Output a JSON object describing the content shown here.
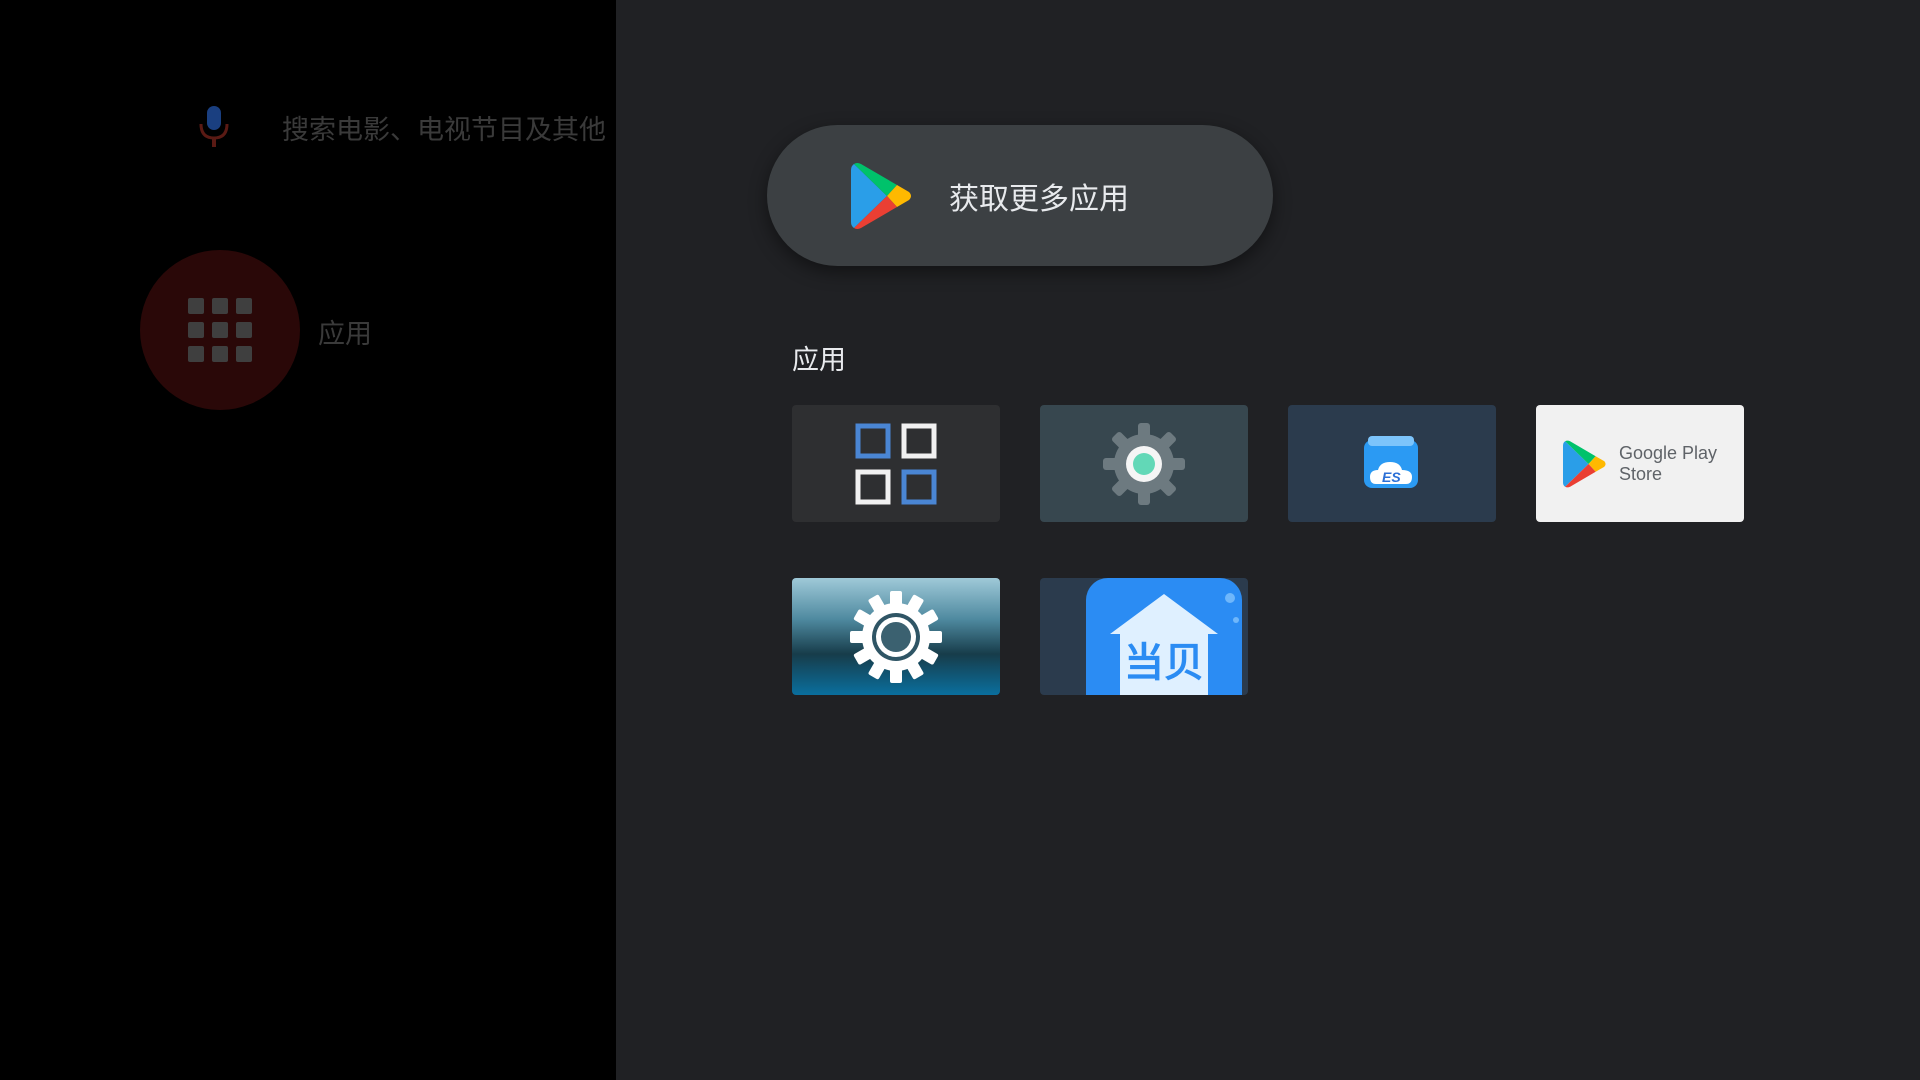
{
  "search": {
    "placeholder": "搜索电影、电视节目及其他"
  },
  "home": {
    "apps_label": "应用"
  },
  "panel": {
    "get_more_label": "获取更多应用",
    "section_title": "应用",
    "apps": [
      {
        "name": "app-grid",
        "icon": "four-squares-icon"
      },
      {
        "name": "settings",
        "icon": "gear-icon"
      },
      {
        "name": "es-file-explorer",
        "icon": "folder-cloud-icon"
      },
      {
        "name": "google-play-store",
        "icon": "play-store-icon",
        "banner_title": "Google Play",
        "banner_sub": "Store"
      },
      {
        "name": "settings-alt",
        "icon": "gear-icon"
      },
      {
        "name": "dangbei",
        "icon": "house-icon",
        "banner_text": "当贝"
      }
    ]
  },
  "colors": {
    "panel_bg": "#202124",
    "pill_bg": "#3c4043",
    "accent_blue": "#4a86d4",
    "dangbei_blue": "#2b8cf3"
  }
}
